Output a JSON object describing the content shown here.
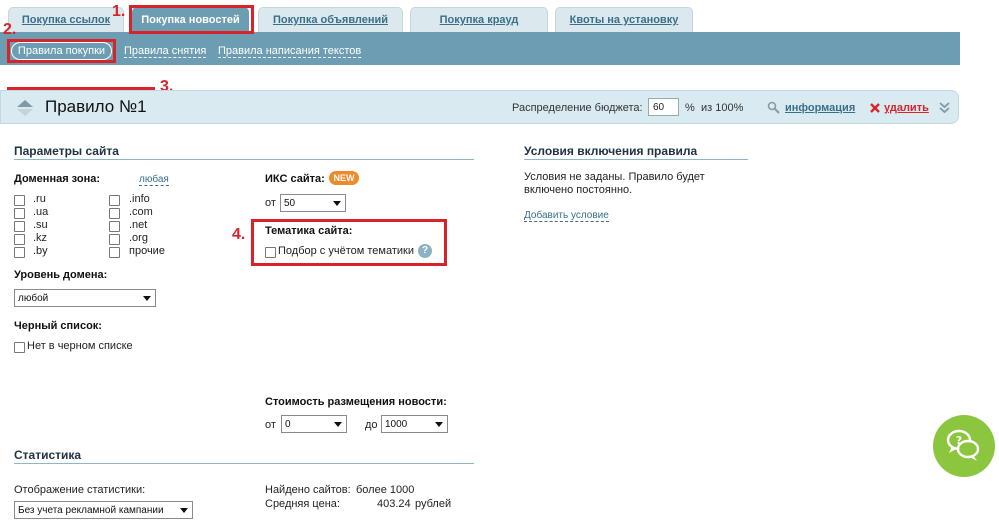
{
  "tabs": [
    {
      "label": "Покупка ссылок"
    },
    {
      "label": "Покупка новостей"
    },
    {
      "label": "Покупка объявлений"
    },
    {
      "label": "Покупка крауд"
    },
    {
      "label": "Квоты на установку"
    }
  ],
  "subtabs": [
    {
      "label": "Правила покупки"
    },
    {
      "label": "Правила снятия"
    },
    {
      "label": "Правила написания текстов"
    }
  ],
  "annotations": [
    "1.",
    "2.",
    "3.",
    "4."
  ],
  "rule": {
    "title": "Правило №1",
    "budget_label": "Распределение бюджета:",
    "budget_value": "60",
    "percent_sign": "%",
    "of_total": "из 100%",
    "info_link": "информация",
    "delete_link": "удалить"
  },
  "params": {
    "title": "Параметры сайта",
    "domain_zone_label": "Доменная зона:",
    "domain_zone_any": "любая",
    "zones_col1": [
      ".ru",
      ".ua",
      ".su",
      ".kz",
      ".by"
    ],
    "zones_col2": [
      ".info",
      ".com",
      ".net",
      ".org",
      "прочие"
    ],
    "domain_level_label": "Уровень домена:",
    "domain_level_value": "любой",
    "blacklist_label": "Черный список:",
    "blacklist_option": "Нет в черном списке",
    "iks_label": "ИКС сайта:",
    "iks_badge": "NEW",
    "from_label": "от",
    "iks_from_value": "50",
    "theme_label": "Тематика сайта:",
    "theme_option": "Подбор с учётом тематики",
    "help_glyph": "?",
    "cost_label": "Стоимость размещения новости:",
    "cost_from_label": "от",
    "cost_from_value": "0",
    "cost_to_label": "до",
    "cost_to_value": "1000"
  },
  "conditions": {
    "title": "Условия включения правила",
    "text_line1": "Условия не заданы. Правило будет",
    "text_line2": "включено постоянно.",
    "add_link": "Добавить условие"
  },
  "stats": {
    "title": "Статистика",
    "display_label": "Отображение статистики:",
    "display_value": "Без учета рекламной кампании",
    "found_label": "Найдено сайтов:",
    "found_value": "более 1000",
    "avg_label": "Средняя цена:",
    "avg_value": "403.24",
    "avg_unit": "рублей"
  },
  "colors": {
    "tab_active": "#6d9db2",
    "tab_inactive": "#dbe9ee",
    "annotation_red": "#d8232a",
    "new_badge": "#ef8a2b",
    "chat_button": "#8cc63f"
  },
  "icons": [
    "collapse-arrow-icon",
    "search-icon",
    "delete-x-icon",
    "expand-chevrons-icon",
    "help-icon",
    "chat-icon"
  ]
}
